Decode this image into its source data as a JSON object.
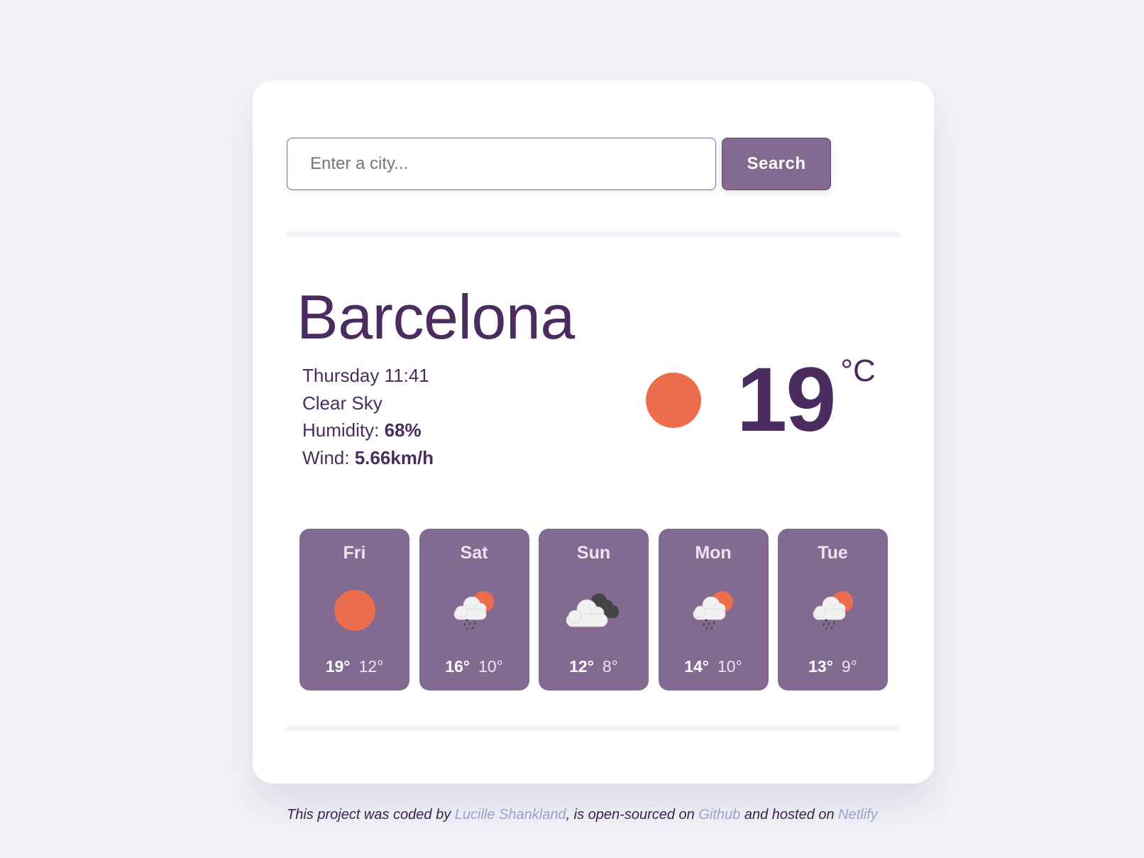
{
  "search": {
    "placeholder": "Enter a city...",
    "value": "",
    "button_label": "Search"
  },
  "current": {
    "city": "Barcelona",
    "datetime": "Thursday 11:41",
    "description": "Clear Sky",
    "humidity_label": "Humidity: ",
    "humidity_value": "68%",
    "wind_label": "Wind: ",
    "wind_value": "5.66km/h",
    "icon": "clear-sky-sun-icon",
    "temperature": "19",
    "unit": "°C"
  },
  "forecast": [
    {
      "day": "Fri",
      "icon": "clear-sky-sun-icon",
      "max": "19°",
      "min": "12°"
    },
    {
      "day": "Sat",
      "icon": "rain-sun-cloud-icon",
      "max": "16°",
      "min": "10°"
    },
    {
      "day": "Sun",
      "icon": "broken-clouds-icon",
      "max": "12°",
      "min": "8°"
    },
    {
      "day": "Mon",
      "icon": "rain-sun-cloud-icon",
      "max": "14°",
      "min": "10°"
    },
    {
      "day": "Tue",
      "icon": "rain-sun-cloud-icon",
      "max": "13°",
      "min": "9°"
    }
  ],
  "footer": {
    "text_1": "This project was coded by ",
    "author_link": "Lucille Shankland",
    "text_2": ", is open-sourced on ",
    "github_link": "Github",
    "text_3": " and hosted on ",
    "netlify_link": "Netlify"
  },
  "colors": {
    "accent": "#836a90",
    "text": "#4a2c5e",
    "sun": "#ec6e4c",
    "link": "#9b9fd1",
    "background": "#f2f3f8"
  }
}
